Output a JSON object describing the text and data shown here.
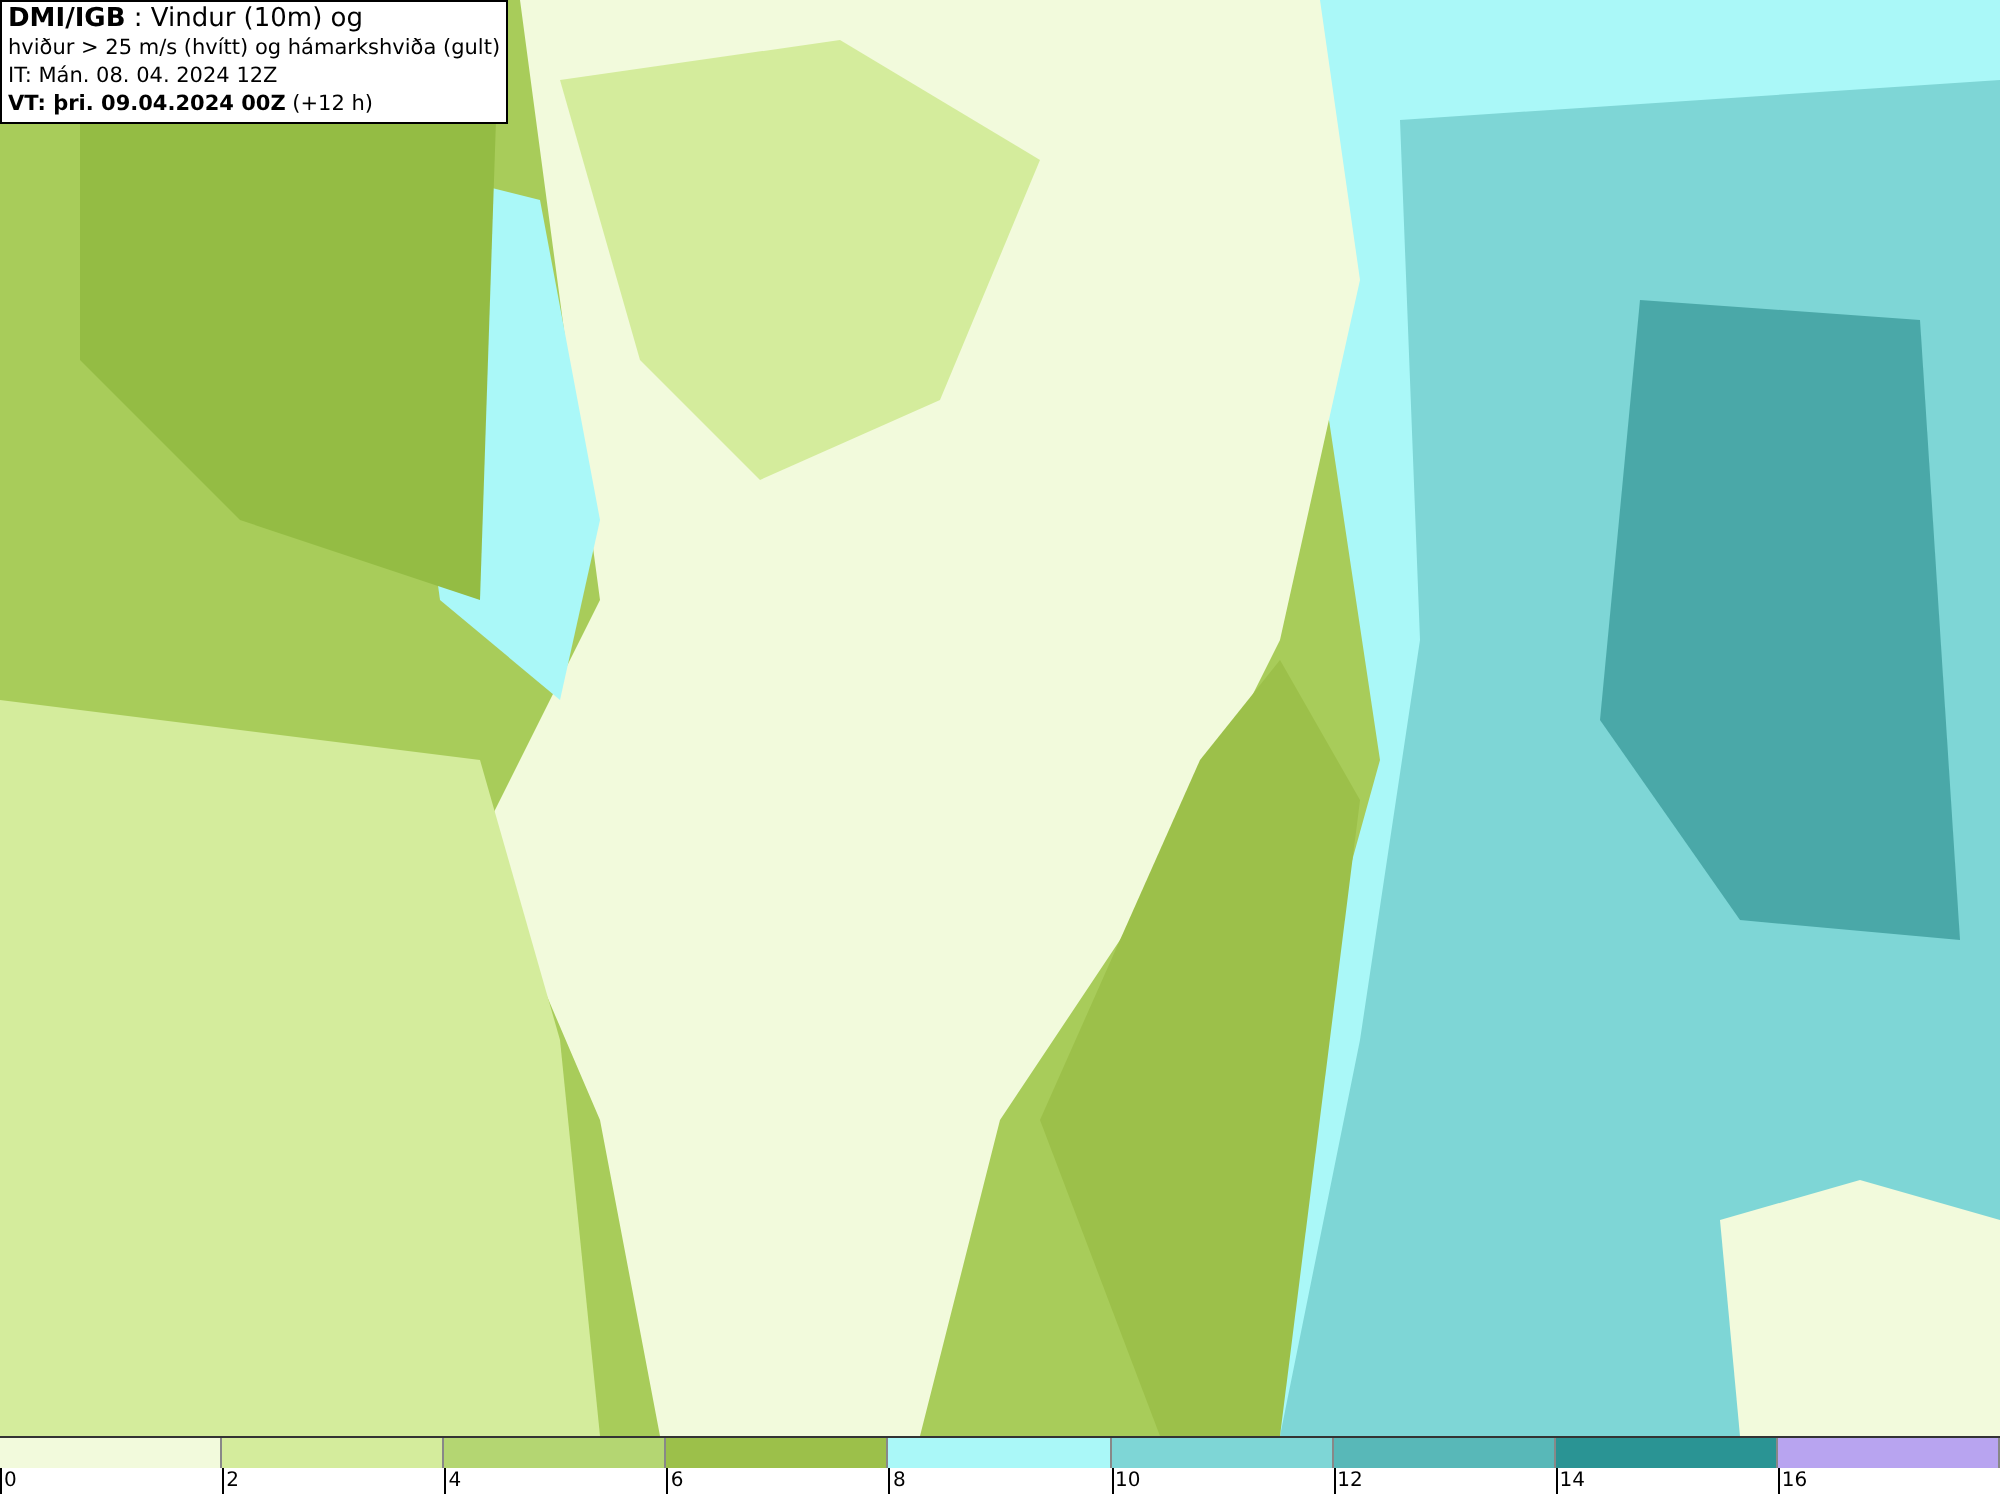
{
  "title_box": {
    "lines": [
      "**DMI/IGB** : Vindur (10m) og",
      "hviður > 25 m/s (hvítt) og hámarkshviða (gult)",
      "IT: Mán. 08. 04. 2024 12Z",
      "**VT: þri. 09.04.2024 00Z** (+12 h)"
    ]
  },
  "legend": [
    {
      "color": "#f2fadc",
      "label": "0"
    },
    {
      "color": "#d4ec9c",
      "label": "2"
    },
    {
      "color": "#b4d672",
      "label": "4"
    },
    {
      "color": "#9cc04a",
      "label": "6"
    },
    {
      "color": "#aaf8f8",
      "label": "8"
    },
    {
      "color": "#7ed6d6",
      "label": "10"
    },
    {
      "color": "#58b8b8",
      "label": "12"
    },
    {
      "color": "#2a9494",
      "label": "14"
    },
    {
      "color": "#b8a4f0",
      "label": "16"
    }
  ]
}
